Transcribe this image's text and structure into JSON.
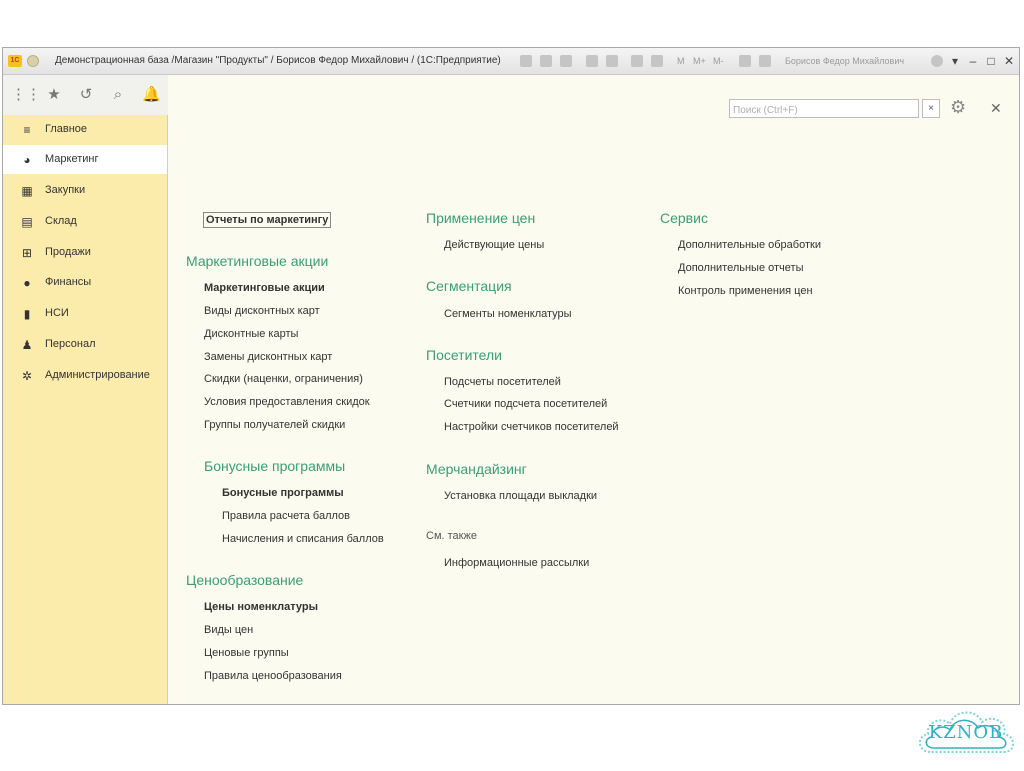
{
  "titlebar": {
    "logo": "1С",
    "title": "Демонстрационная база /Магазин \"Продукты\" / Борисов Федор Михайлович / (1С:Предприятие)",
    "memory": [
      "M",
      "M+",
      "M-"
    ],
    "user": "Борисов Федор Михайлович"
  },
  "search": {
    "placeholder": "Поиск (Ctrl+F)",
    "clear": "×"
  },
  "sidebar": {
    "items": [
      {
        "label": "Главное",
        "icon": "menu-icon"
      },
      {
        "label": "Маркетинг",
        "icon": "pie-chart-icon"
      },
      {
        "label": "Закупки",
        "icon": "cart-icon"
      },
      {
        "label": "Склад",
        "icon": "warehouse-icon"
      },
      {
        "label": "Продажи",
        "icon": "basket-icon"
      },
      {
        "label": "Финансы",
        "icon": "coin-icon"
      },
      {
        "label": "НСИ",
        "icon": "books-icon"
      },
      {
        "label": "Персонал",
        "icon": "person-icon"
      },
      {
        "label": "Администрирование",
        "icon": "gear-icon"
      }
    ]
  },
  "content": {
    "col1": {
      "reports_link": "Отчеты по маркетингу",
      "promo_heading": "Маркетинговые акции",
      "promo_items": [
        "Маркетинговые акции",
        "Виды дисконтных карт",
        "Дисконтные карты",
        "Замены дисконтных карт",
        "Скидки (наценки, ограничения)",
        "Условия предоставления скидок",
        "Группы получателей скидки"
      ],
      "bonus_heading": "Бонусные программы",
      "bonus_items": [
        "Бонусные программы",
        "Правила расчета баллов",
        "Начисления и списания баллов"
      ],
      "pricing_heading": "Ценообразование",
      "pricing_items": [
        "Цены номенклатуры",
        "Виды цен",
        "Ценовые группы",
        "Правила ценообразования"
      ]
    },
    "col2": {
      "prices_heading": "Применение цен",
      "prices_items": [
        "Действующие цены"
      ],
      "segment_heading": "Сегментация",
      "segment_items": [
        "Сегменты номенклатуры"
      ],
      "visitors_heading": "Посетители",
      "visitors_items": [
        "Подсчеты посетителей",
        "Счетчики подсчета посетителей",
        "Настройки счетчиков посетителей"
      ],
      "merch_heading": "Мерчандайзинг",
      "merch_items": [
        "Установка площади выкладки"
      ],
      "see_also": "См. также",
      "see_also_items": [
        "Информационные рассылки"
      ]
    },
    "col3": {
      "service_heading": "Сервис",
      "service_items": [
        "Дополнительные обработки",
        "Дополнительные отчеты",
        "Контроль применения цен"
      ]
    }
  },
  "watermark": "KZNOB"
}
